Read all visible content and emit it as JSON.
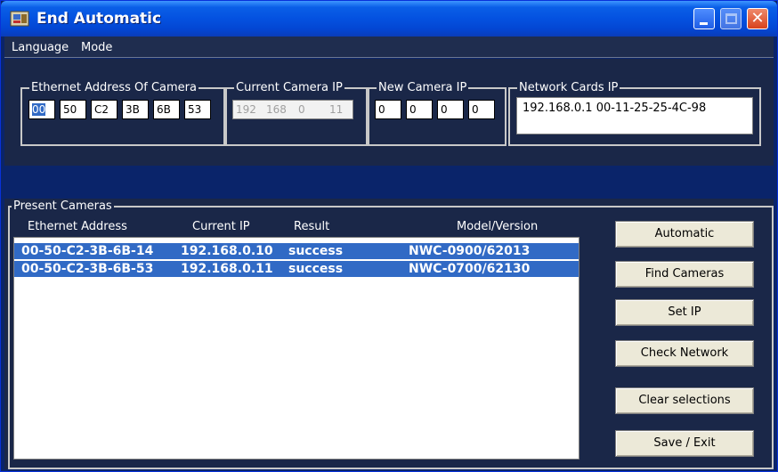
{
  "window": {
    "title": "End Automatic"
  },
  "menu": {
    "language": "Language",
    "mode": "Mode"
  },
  "ethernet": {
    "label": "Ethernet Address Of Camera",
    "octets": [
      "00",
      "50",
      "C2",
      "3B",
      "6B",
      "53"
    ]
  },
  "current_ip": {
    "label": "Current Camera IP",
    "octets": [
      "192",
      "168",
      "0",
      "11"
    ]
  },
  "new_ip": {
    "label": "New Camera IP",
    "octets": [
      "0",
      "0",
      "0",
      "0"
    ]
  },
  "network_cards": {
    "label": "Network Cards IP",
    "entries": [
      "192.168.0.1  00-11-25-25-4C-98"
    ]
  },
  "present": {
    "label": "Present Cameras",
    "columns": [
      "Ethernet Address",
      "Current IP",
      "Result",
      "Model/Version"
    ],
    "rows": [
      {
        "mac": "00-50-C2-3B-6B-14",
        "ip": "192.168.0.10",
        "result": "success",
        "model": "NWC-0900/62013"
      },
      {
        "mac": "00-50-C2-3B-6B-53",
        "ip": "192.168.0.11",
        "result": "success",
        "model": "NWC-0700/62130"
      }
    ]
  },
  "buttons": {
    "automatic": "Automatic",
    "find": "Find Cameras",
    "set_ip": "Set IP",
    "check": "Check Network",
    "clear": "Clear selections",
    "save": "Save / Exit"
  }
}
